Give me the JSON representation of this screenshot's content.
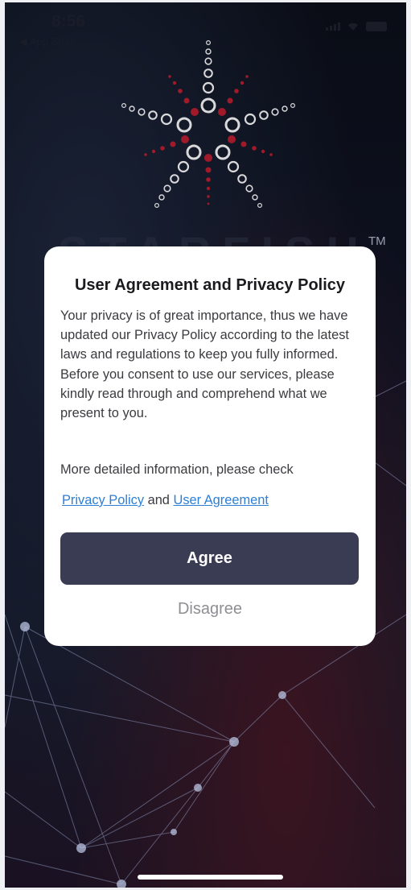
{
  "status_bar": {
    "time": "8:56",
    "back_label": "◀ App Store"
  },
  "background": {
    "brand_text": "STARFISH",
    "trademark": "TM",
    "logo_icon": "starfish-logo-icon"
  },
  "dialog": {
    "title": "User Agreement and Privacy Policy",
    "paragraph_1": "Your privacy is of great importance, thus we have updated our Privacy Policy according to the latest laws and regulations to keep you fully informed.",
    "paragraph_2": "Before you consent to use our services, please kindly read through and comprehend what we present to you.",
    "more_info": "More detailed information, please check",
    "privacy_link": "Privacy Policy",
    "link_joiner": "and",
    "agreement_link": "User Agreement",
    "agree_label": "Agree",
    "disagree_label": "Disagree"
  },
  "colors": {
    "primary_button": "#3a3c54",
    "link": "#2d7fd6",
    "accent_red": "#a01a2a"
  }
}
